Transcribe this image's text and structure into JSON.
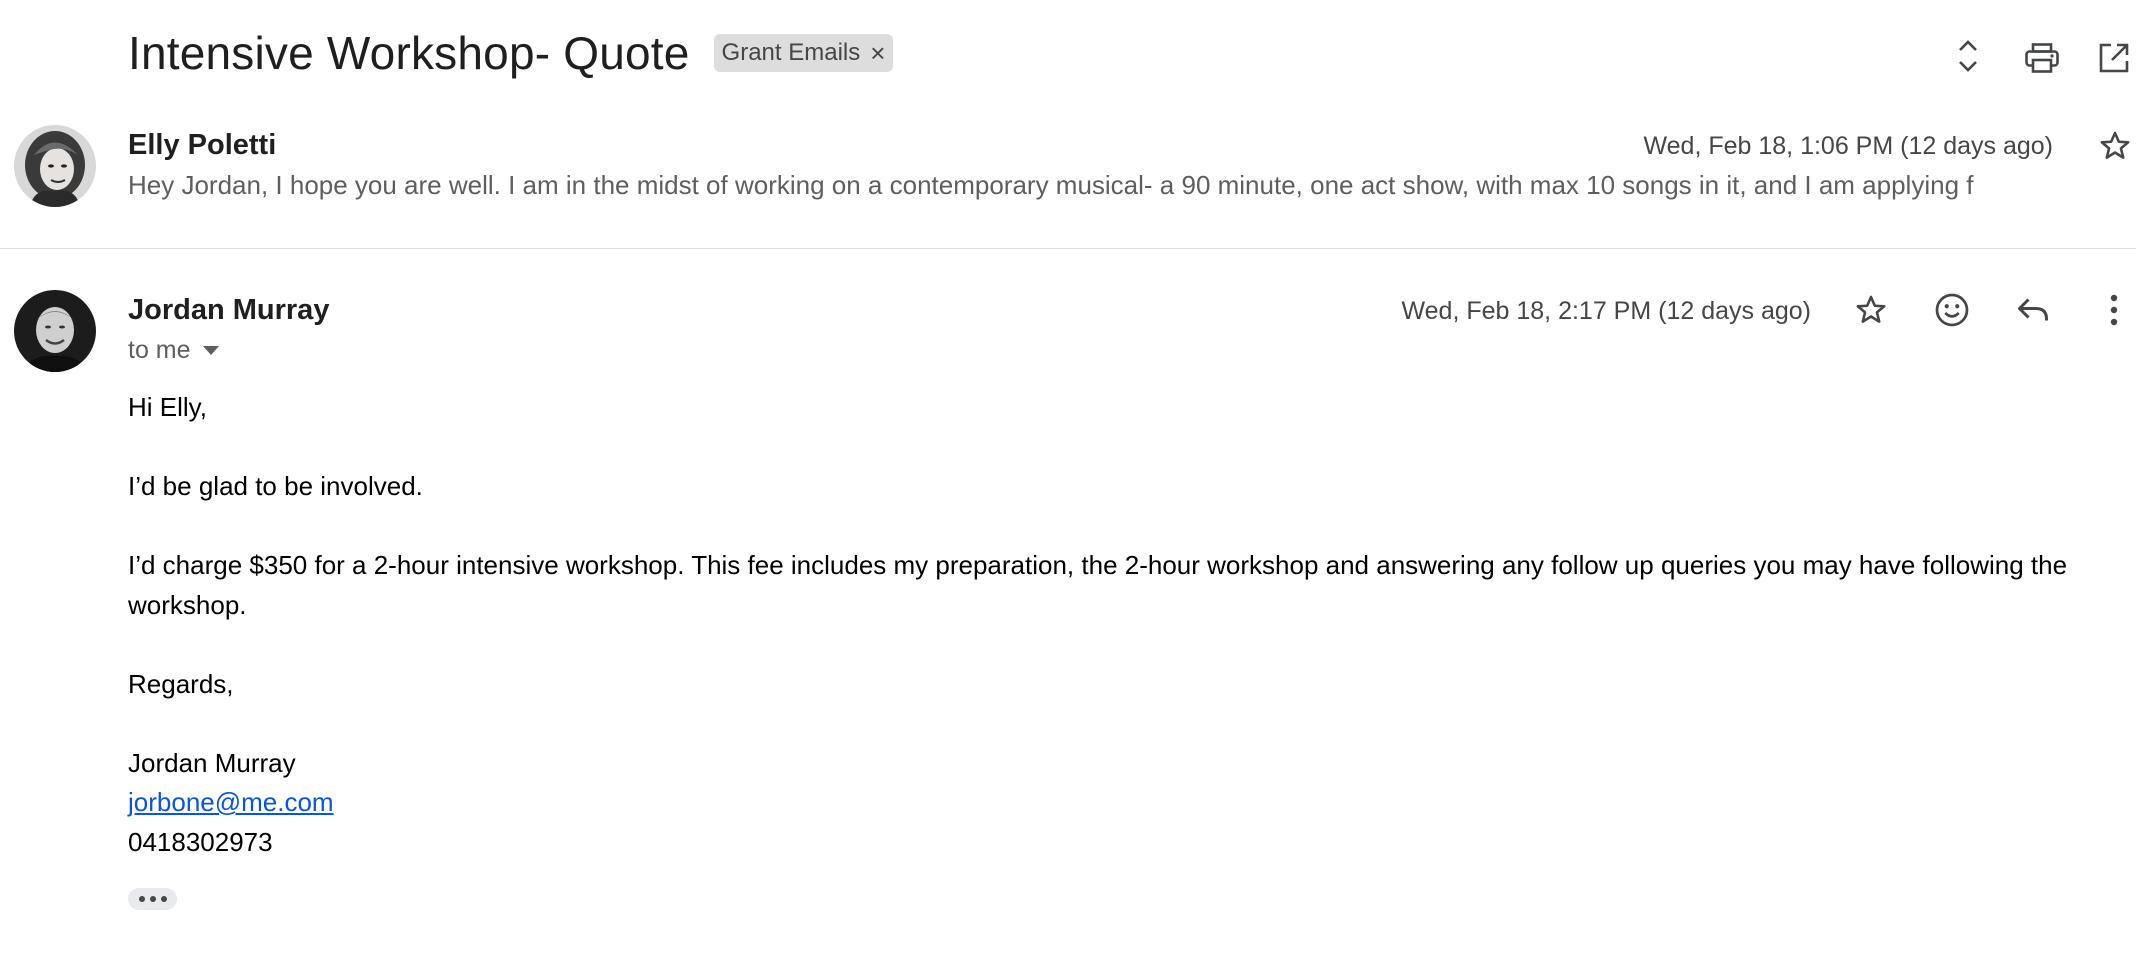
{
  "thread": {
    "subject": "Intensive Workshop- Quote",
    "label_chip": "Grant Emails",
    "label_remove": "×"
  },
  "toolbar": {
    "icons": [
      "expand-collapse-icon",
      "print-icon",
      "open-new-window-icon"
    ]
  },
  "messages": [
    {
      "sender": "Elly Poletti",
      "date": "Wed, Feb 18, 1:06 PM (12 days ago)",
      "snippet": "Hey Jordan, I hope you are well. I am in the midst of working on a contemporary musical- a 90 minute, one act show, with max 10 songs in it, and I am applying f",
      "starred": false
    },
    {
      "sender": "Jordan Murray",
      "date": "Wed, Feb 18, 2:17 PM (12 days ago)",
      "recipients": "to me",
      "body": {
        "greeting": "Hi Elly,",
        "line1": "I’d be glad to be involved.",
        "line2": "I’d charge $350 for a 2-hour intensive workshop. This fee includes my preparation, the 2-hour workshop and answering any follow up queries you may have following the workshop.",
        "closing": "Regards,",
        "sig_name": "Jordan Murray",
        "sig_email": "jorbone@me.com",
        "sig_phone": "0418302973"
      },
      "actions": [
        "star-icon",
        "emoji-reaction-icon",
        "reply-icon",
        "more-vert-icon"
      ]
    }
  ],
  "colors": {
    "link": "#0b57d0",
    "chip_bg": "#dddddd",
    "muted_text": "#5e5e5e",
    "divider": "#e0e0e0"
  }
}
